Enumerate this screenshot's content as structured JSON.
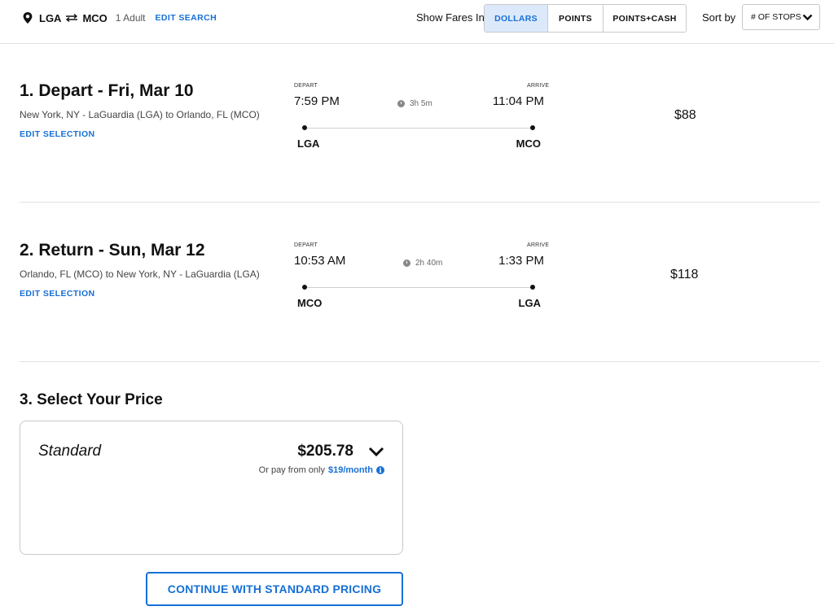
{
  "header": {
    "origin": "LGA",
    "destination": "MCO",
    "swap_icon": "swap-arrows-icon",
    "travelers": "1 Adult",
    "edit_search": "EDIT SEARCH",
    "show_fares_label": "Show Fares In",
    "fare_options": [
      "DOLLARS",
      "POINTS",
      "POINTS+CASH"
    ],
    "fare_selected": "DOLLARS",
    "sort_label": "Sort by",
    "sort_value": "# OF STOPS"
  },
  "flights": [
    {
      "title": "1. Depart - Fri, Mar 10",
      "subtitle": "New York, NY - LaGuardia (LGA) to Orlando, FL (MCO)",
      "edit": "EDIT SELECTION",
      "depart_label": "DEPART",
      "arrive_label": "ARRIVE",
      "depart_time": "7:59 PM",
      "arrive_time": "11:04 PM",
      "duration": "3h 5m",
      "from": "LGA",
      "to": "MCO",
      "price": "$88"
    },
    {
      "title": "2. Return - Sun, Mar 12",
      "subtitle": "Orlando, FL (MCO) to New York, NY - LaGuardia (LGA)",
      "edit": "EDIT SELECTION",
      "depart_label": "DEPART",
      "arrive_label": "ARRIVE",
      "depart_time": "10:53 AM",
      "arrive_time": "1:33 PM",
      "duration": "2h 40m",
      "from": "MCO",
      "to": "LGA",
      "price": "$118"
    }
  ],
  "select_price": {
    "title": "3. Select Your Price",
    "option_name": "Standard",
    "total": "$205.78",
    "pay_prefix": "Or pay from only",
    "pay_amount": "$19/month",
    "info_glyph": "i",
    "continue_label": "CONTINUE WITH STANDARD PRICING"
  },
  "colors": {
    "accent": "#1670d6",
    "accent_bg": "#dce9fb",
    "divider": "#e2e2e2"
  }
}
